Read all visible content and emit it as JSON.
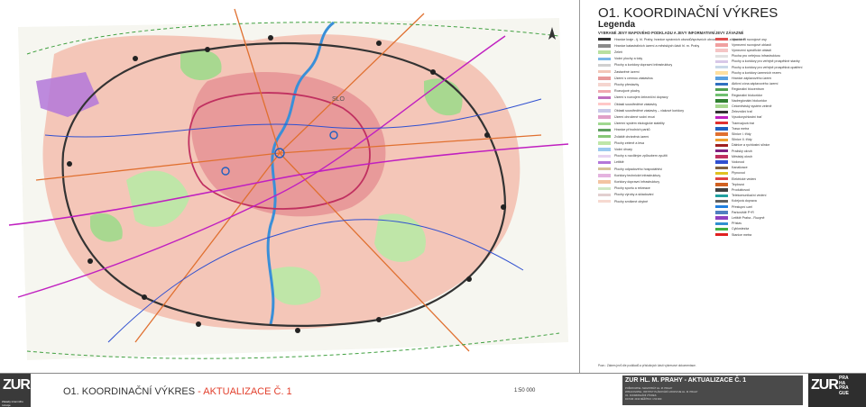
{
  "legend": {
    "title": "O1. KOORDINAČNÍ VÝKRES",
    "subtitle": "Legenda",
    "col1_head": "VYBRANÉ JEVY MAPOVÉHO PODKLADU A JEVY INFORMATIVNÍ",
    "col2_head": "JEVY ZÁVAZNÉ",
    "col1_items": [
      {
        "text": "Hranice kraje - tj. hl. Prahy; hranice správních obvodů/správních obvodů hl.m.P. a obcí hl. P.",
        "color": "#333333"
      },
      {
        "text": "Hranice katastrálních území a městských částí hl. m. Prahy",
        "color": "#8a8a8a"
      },
      {
        "text": "Zeleň",
        "color": "#b8e0a0"
      },
      {
        "text": "Vodní plochy a toky",
        "color": "#7ab8e8"
      },
      {
        "text": "Plochy a koridory dopravní infrastruktury",
        "color": "#d0d0d0"
      },
      {
        "text": "Zastavěné území",
        "color": "#f2c7b8"
      },
      {
        "text": "Území s cennou zástavbou",
        "color": "#e89a9a"
      },
      {
        "text": "Plochy přestavby",
        "color": "#f5d5cf"
      },
      {
        "text": "Rozvojové plochy",
        "color": "#f0a8b0"
      },
      {
        "text": "Území s rozvojem železniční dopravy",
        "color": "#c070c0"
      },
      {
        "text": "Oblasti soustředěné zástavby",
        "color": "#ffc8c8"
      },
      {
        "text": "Oblasti soustředěné zástavby – vlakové koridory",
        "color": "#c8c8e8"
      },
      {
        "text": "Území ohrožené vodní erozí",
        "color": "#e0a0c8"
      },
      {
        "text": "Územní systém ekologické stability",
        "color": "#a0d890"
      },
      {
        "text": "Hranice přírodních parků",
        "color": "#60a060"
      },
      {
        "text": "Zvláště chráněná území",
        "color": "#88c878"
      },
      {
        "text": "Plochy zeleně a lesa",
        "color": "#bfe6a8"
      },
      {
        "text": "Vodní útvary",
        "color": "#9bc9ef"
      },
      {
        "text": "Plochy s rozdílným způsobem využití",
        "color": "#e6d2f0"
      },
      {
        "text": "Letiště",
        "color": "#b377d9"
      },
      {
        "text": "Plochy odpadového hospodářství",
        "color": "#d6c39a"
      },
      {
        "text": "Koridory technické infrastruktury",
        "color": "#e4b3df"
      },
      {
        "text": "Koridory dopravní infrastruktury",
        "color": "#f3c4a2"
      },
      {
        "text": "Plochy sportu a rekreace",
        "color": "#cfe8c4"
      },
      {
        "text": "Plochy výroby a skladování",
        "color": "#e2cfcf"
      },
      {
        "text": "Plochy smíšené obytné",
        "color": "#f6d9d0"
      }
    ],
    "col2_items": [
      {
        "text": "Vymezení rozvojové osy",
        "color": "#e05050"
      },
      {
        "text": "Vymezení rozvojové oblasti",
        "color": "#f0a0a0"
      },
      {
        "text": "Vymezení specifické oblasti",
        "color": "#f5c5c5"
      },
      {
        "text": "Plocha pro veřejnou infrastrukturu",
        "color": "#e0e0e0"
      },
      {
        "text": "Plochy a koridory pro veřejně prospěšné stavby",
        "color": "#d8c8e8"
      },
      {
        "text": "Plochy a koridory pro veřejně prospěšná opatření",
        "color": "#c8d8e8"
      },
      {
        "text": "Plochy a koridory územních rezerv",
        "color": "#ffe0a0"
      },
      {
        "text": "Hranice záplavového území",
        "color": "#5aa0e0"
      },
      {
        "text": "Aktivní zóna záplavového území",
        "color": "#3070c0"
      },
      {
        "text": "Regionální biocentrum",
        "color": "#50a050"
      },
      {
        "text": "Regionální biokoridor",
        "color": "#70c070"
      },
      {
        "text": "Nadregionální biokoridor",
        "color": "#308030"
      },
      {
        "text": "Celoměstský systém zeleně",
        "color": "#a8d890"
      },
      {
        "text": "Železniční trať",
        "color": "#333333"
      },
      {
        "text": "Vysokorychlostní trať",
        "color": "#c020c0"
      },
      {
        "text": "Tramvajová trať",
        "color": "#e03030"
      },
      {
        "text": "Trasa metra",
        "color": "#2060c0"
      },
      {
        "text": "Silnice I. třídy",
        "color": "#e07030"
      },
      {
        "text": "Silnice II. třídy",
        "color": "#f0a030"
      },
      {
        "text": "Dálnice a rychlostní silnice",
        "color": "#a02020"
      },
      {
        "text": "Pražský okruh",
        "color": "#802080"
      },
      {
        "text": "Městský okruh",
        "color": "#c03060"
      },
      {
        "text": "Vodovod",
        "color": "#3050d0"
      },
      {
        "text": "Kanalizace",
        "color": "#806040"
      },
      {
        "text": "Plynovod",
        "color": "#e0c020"
      },
      {
        "text": "Elektrické vedení",
        "color": "#e04040"
      },
      {
        "text": "Teplovod",
        "color": "#d06020"
      },
      {
        "text": "Produktovod",
        "color": "#404040"
      },
      {
        "text": "Telekomunikační vedení",
        "color": "#20a0a0"
      },
      {
        "text": "Kolejová doprava",
        "color": "#606060"
      },
      {
        "text": "Přestupní uzel",
        "color": "#2080e0"
      },
      {
        "text": "Parkoviště P+R",
        "color": "#5080c0"
      },
      {
        "text": "Letiště Praha - Ruzyně",
        "color": "#9040c0"
      },
      {
        "text": "Přístav",
        "color": "#3090d0"
      },
      {
        "text": "Cyklostezka",
        "color": "#40b040"
      },
      {
        "text": "Stanice metra",
        "color": "#e02020"
      }
    ]
  },
  "note": "Pozn.: Zákres jevů dle podkladů a příslušných částí výkresové dokumentace.",
  "footer": {
    "title_black": "O1. KOORDINAČNÍ VÝKRES",
    "title_red": " - AKTUALIZACE Č. 1",
    "scale": "1:50 000",
    "zur_mark": "ZUR",
    "zur_small": "Zásady územního rozvoje",
    "block_title": "ZUR HL. M. PRAHY - AKTUALIZACE Č. 1",
    "block_rows": [
      "POŘIZOVATEL: MAGISTRÁT HL. M. PRAHY",
      "ZPRACOVATEL: INSTITUT PLÁNOVÁNÍ A ROZVOJE HL. M. PRAHY",
      "O1. KOORDINAČNÍ VÝKRES",
      "DATUM: 2013   MĚŘÍTKO: 1:50 000"
    ],
    "praha_lines": [
      "PRA",
      "HA",
      "PRA",
      "GUE"
    ]
  },
  "map_labels": [
    "SLO"
  ]
}
